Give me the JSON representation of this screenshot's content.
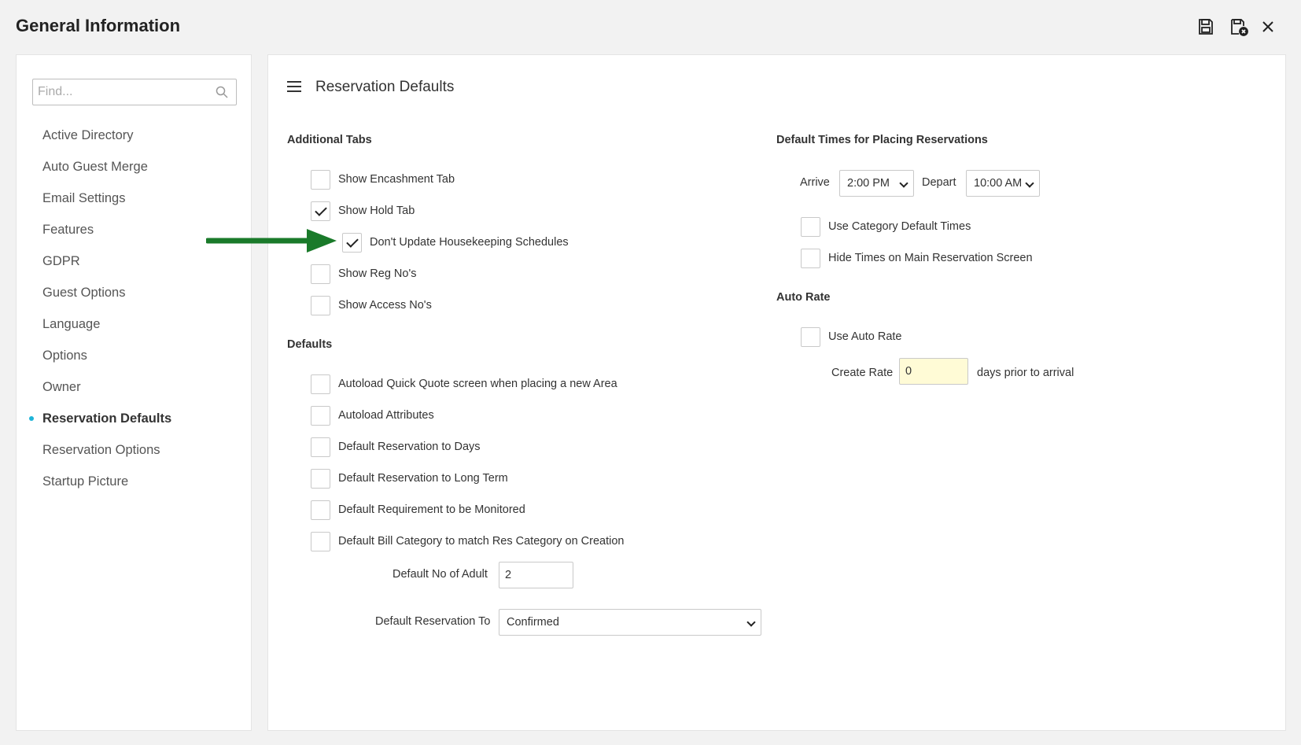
{
  "window": {
    "title": "General Information",
    "icons": [
      "save-icon",
      "save-close-icon",
      "close-icon"
    ]
  },
  "sidebar": {
    "search_placeholder": "Find...",
    "items": [
      {
        "label": "Active Directory"
      },
      {
        "label": "Auto Guest Merge"
      },
      {
        "label": "Email Settings"
      },
      {
        "label": "Features"
      },
      {
        "label": "GDPR"
      },
      {
        "label": "Guest Options"
      },
      {
        "label": "Language"
      },
      {
        "label": "Options"
      },
      {
        "label": "Owner"
      },
      {
        "label": "Reservation Defaults",
        "active": true
      },
      {
        "label": "Reservation Options"
      },
      {
        "label": "Startup Picture"
      }
    ]
  },
  "main": {
    "title": "Reservation Defaults",
    "additional_tabs": {
      "heading": "Additional Tabs",
      "items": [
        {
          "label": "Show Encashment Tab",
          "checked": false
        },
        {
          "label": "Show Hold Tab",
          "checked": true
        },
        {
          "label": "Don't Update Housekeeping Schedules",
          "checked": true
        },
        {
          "label": "Show Reg No's",
          "checked": false
        },
        {
          "label": "Show Access No's",
          "checked": false
        }
      ]
    },
    "defaults": {
      "heading": "Defaults",
      "items": [
        {
          "label": "Autoload Quick Quote screen when placing a new Area",
          "checked": false
        },
        {
          "label": "Autoload Attributes",
          "checked": false
        },
        {
          "label": "Default Reservation to Days",
          "checked": false
        },
        {
          "label": "Default Reservation to Long Term",
          "checked": false
        },
        {
          "label": "Default Requirement to be Monitored",
          "checked": false
        },
        {
          "label": "Default Bill Category to match Res Category on Creation",
          "checked": false
        }
      ],
      "adult_label": "Default No of Adult",
      "adult_value": "2",
      "res_to_label": "Default Reservation To",
      "res_to_value": "Confirmed"
    },
    "default_times": {
      "heading": "Default Times for Placing Reservations",
      "arrive_label": "Arrive",
      "arrive_value": "2:00 PM",
      "depart_label": "Depart",
      "depart_value": "10:00 AM",
      "items": [
        {
          "label": "Use Category Default Times",
          "checked": false
        },
        {
          "label": "Hide Times on Main Reservation Screen",
          "checked": false
        }
      ]
    },
    "auto_rate": {
      "heading": "Auto Rate",
      "use_label": "Use Auto Rate",
      "use_checked": false,
      "create_rate_label": "Create Rate",
      "create_rate_value": "0",
      "suffix": "days prior to arrival"
    }
  },
  "colors": {
    "accent": "#1eb4d8",
    "arrow": "#1a7a2a",
    "highlight_input": "#fffbd6"
  }
}
